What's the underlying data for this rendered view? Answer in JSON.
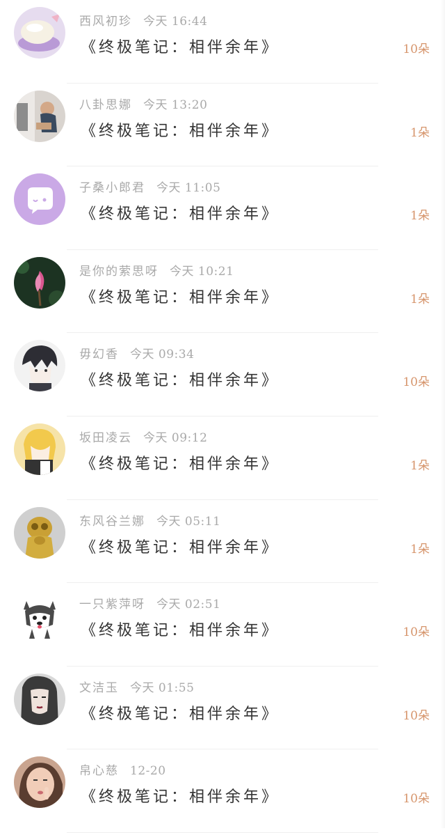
{
  "items": [
    {
      "name": "西风初珍",
      "time": "今天 16:44",
      "title": "《终极笔记：相伴余年》",
      "count": "10朵",
      "avatar": "rice-bowl-icon",
      "bg": "#e6dcef"
    },
    {
      "name": "八卦思娜",
      "time": "今天 13:20",
      "title": "《终极笔记：相伴余年》",
      "count": "1朵",
      "avatar": "child-photo-icon",
      "bg": "#d9d4cf"
    },
    {
      "name": "子桑小郎君",
      "time": "今天 11:05",
      "title": "《终极笔记：相伴余年》",
      "count": "1朵",
      "avatar": "chat-bubble-icon",
      "bg": "#caa9e6"
    },
    {
      "name": "是你的萦思呀",
      "time": "今天 10:21",
      "title": "《终极笔记：相伴余年》",
      "count": "1朵",
      "avatar": "magnolia-icon",
      "bg": "#1c3322"
    },
    {
      "name": "毋幻香",
      "time": "今天 09:34",
      "title": "《终极笔记：相伴余年》",
      "count": "10朵",
      "avatar": "anime-boy-icon",
      "bg": "#f2f2f2"
    },
    {
      "name": "坂田凌云",
      "time": "今天 09:12",
      "title": "《终极笔记：相伴余年》",
      "count": "1朵",
      "avatar": "anime-girl-icon",
      "bg": "#f6e3a8"
    },
    {
      "name": "东风谷兰娜",
      "time": "今天 05:11",
      "title": "《终极笔记：相伴余年》",
      "count": "1朵",
      "avatar": "figurine-icon",
      "bg": "#cfcfcf"
    },
    {
      "name": "一只紫萍呀",
      "time": "今天 02:51",
      "title": "《终极笔记：相伴余年》",
      "count": "10朵",
      "avatar": "husky-dog-icon",
      "bg": "#ffffff"
    },
    {
      "name": "文洁玉",
      "time": "今天 01:55",
      "title": "《终极笔记：相伴余年》",
      "count": "10朵",
      "avatar": "portrait-girl-icon",
      "bg": "#d8d8d8"
    },
    {
      "name": "帛心慈",
      "time": "12-20",
      "title": "《终极笔记：相伴余年》",
      "count": "10朵",
      "avatar": "selfie-girl-icon",
      "bg": "#c9a48f"
    }
  ]
}
